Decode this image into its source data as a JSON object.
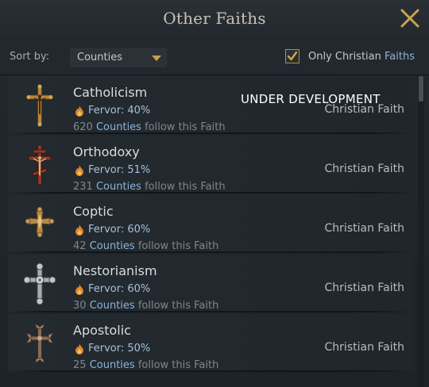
{
  "window": {
    "title": "Other Faiths"
  },
  "toolbar": {
    "sort_label": "Sort by:",
    "sort_value": "Counties",
    "only_prefix": "Only Christian ",
    "only_highlight": "Faiths",
    "only_checked": true
  },
  "banner": "UNDER DEVELOPMENT",
  "faiths": [
    {
      "name": "Catholicism",
      "fervor": "Fervor: 40%",
      "count": "620",
      "counties_word": "Counties",
      "follow_text": " follow this Faith",
      "type": "Christian Faith",
      "icon": "catholic-cross-icon"
    },
    {
      "name": "Orthodoxy",
      "fervor": "Fervor: 51%",
      "count": "231",
      "counties_word": "Counties",
      "follow_text": " follow this Faith",
      "type": "Christian Faith",
      "icon": "orthodox-cross-icon"
    },
    {
      "name": "Coptic",
      "fervor": "Fervor: 60%",
      "count": "42",
      "counties_word": "Counties",
      "follow_text": " follow this Faith",
      "type": "Christian Faith",
      "icon": "coptic-cross-icon"
    },
    {
      "name": "Nestorianism",
      "fervor": "Fervor: 60%",
      "count": "30",
      "counties_word": "Counties",
      "follow_text": " follow this Faith",
      "type": "Christian Faith",
      "icon": "nestorian-cross-icon"
    },
    {
      "name": "Apostolic",
      "fervor": "Fervor: 50%",
      "count": "25",
      "counties_word": "Counties",
      "follow_text": " follow this Faith",
      "type": "Christian Faith",
      "icon": "apostolic-cross-icon"
    }
  ],
  "colors": {
    "accent_gold": "#c6a04f",
    "link_blue": "#8fb3d6",
    "panel_bg": "#1f262c"
  },
  "icons": {
    "close": "close-icon",
    "dropdown": "chevron-down-icon",
    "check": "checkmark-icon",
    "fervor": "flame-icon"
  }
}
